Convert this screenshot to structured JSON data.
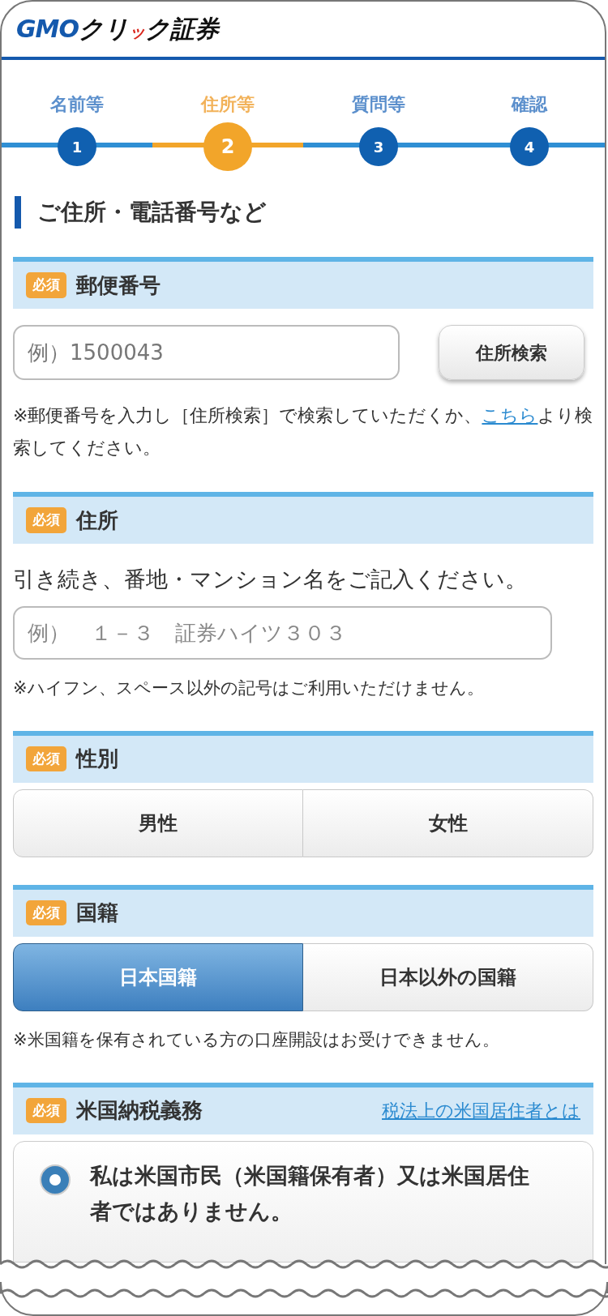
{
  "logo": {
    "brand": "GMO",
    "name_before": "クリ",
    "accent": "ッ",
    "name_after": "ク証券"
  },
  "steps": [
    {
      "label": "名前等",
      "number": "1",
      "selected": false
    },
    {
      "label": "住所等",
      "number": "2",
      "selected": true
    },
    {
      "label": "質問等",
      "number": "3",
      "selected": false
    },
    {
      "label": "確認",
      "number": "4",
      "selected": false
    }
  ],
  "heading": "ご住所・電話番号など",
  "sections": [
    {
      "kind": "postal",
      "badge": "必須",
      "title": "郵便番号",
      "placeholder": "例）1500043",
      "button": "住所検索",
      "note_before": "※郵便番号を入力し［住所検索］で検索していただくか、",
      "note_link": "こちら",
      "note_after": "より検索してください。"
    },
    {
      "kind": "address",
      "badge": "必須",
      "title": "住所",
      "instruction": "引き続き、番地・マンション名をご記入ください。",
      "placeholder": "例）　１－３　証券ハイツ３０３",
      "note": "※ハイフン、スペース以外の記号はご利用いただけません。"
    },
    {
      "kind": "toggle",
      "badge": "必須",
      "title": "性別",
      "options": [
        {
          "label": "男性",
          "selected": false
        },
        {
          "label": "女性",
          "selected": false
        }
      ]
    },
    {
      "kind": "toggle",
      "badge": "必須",
      "title": "国籍",
      "options": [
        {
          "label": "日本国籍",
          "selected": true
        },
        {
          "label": "日本以外の国籍",
          "selected": false
        }
      ],
      "note": "※米国籍を保有されている方の口座開設はお受けできません。"
    },
    {
      "kind": "radio",
      "badge": "必須",
      "title": "米国納税義務",
      "link": "税法上の米国居住者とは",
      "options": [
        {
          "label": "私は米国市民（米国籍保有者）又は米国居住者ではありません。",
          "selected": true
        }
      ]
    }
  ]
}
